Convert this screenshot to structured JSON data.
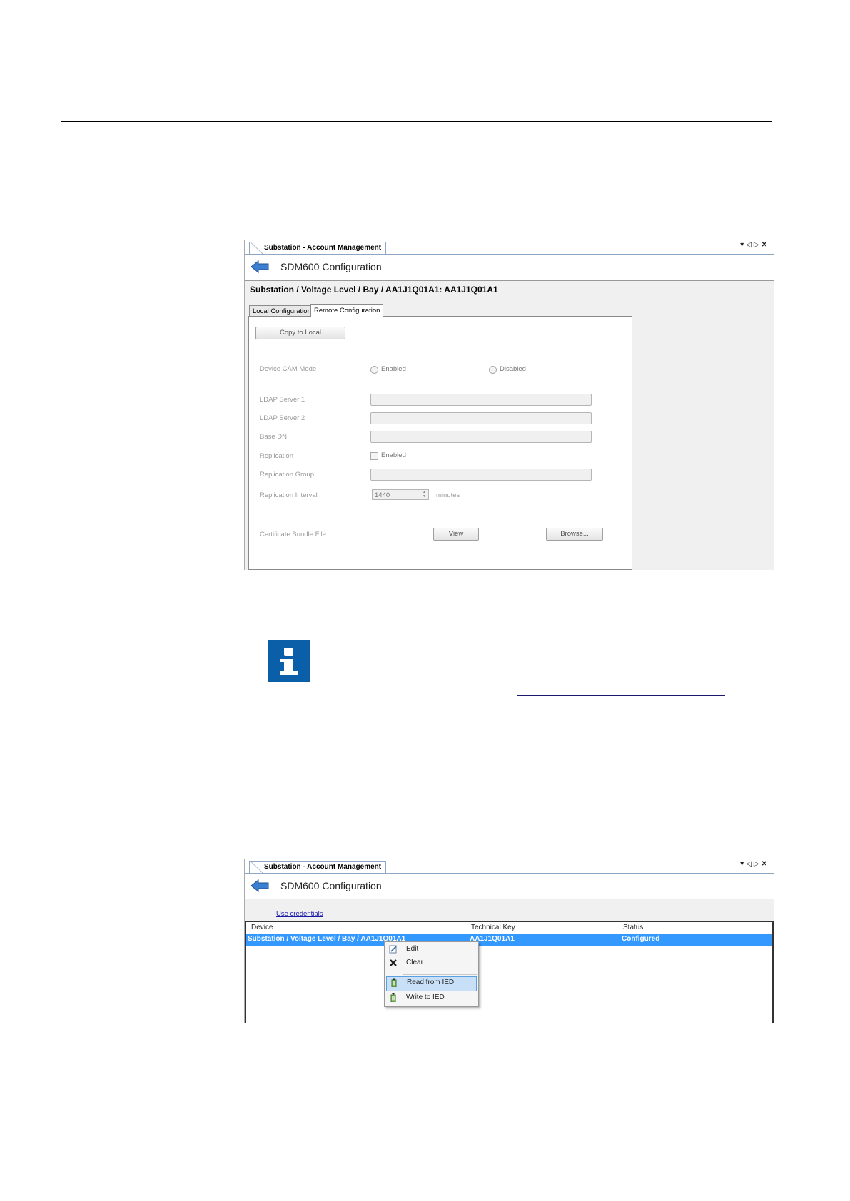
{
  "screenshot1": {
    "doc_tab": "Substation - Account Management",
    "header_title": "SDM600 Configuration",
    "breadcrumb": "Substation / Voltage Level / Bay / AA1J1Q01A1: AA1J1Q01A1",
    "tabs": [
      "Local Configuration",
      "Remote Configuration"
    ],
    "active_tab": "Remote Configuration",
    "copy_button": "Copy to Local",
    "labels": {
      "cam_mode": "Device CAM Mode",
      "ldap1": "LDAP Server 1",
      "ldap2": "LDAP Server 2",
      "base_dn": "Base DN",
      "replication": "Replication",
      "replication_group": "Replication Group",
      "replication_interval": "Replication Interval",
      "cert_bundle": "Certificate Bundle File"
    },
    "options": {
      "enabled": "Enabled",
      "disabled": "Disabled",
      "replication_enabled": "Enabled"
    },
    "interval_value": "1440",
    "interval_unit": "minutes",
    "view_button": "View",
    "browse_button": "Browse..."
  },
  "screenshot2": {
    "doc_tab": "Substation - Account Management",
    "header_title": "SDM600 Configuration",
    "use_credentials": "Use credentials",
    "columns": [
      "Device",
      "Technical Key",
      "Status"
    ],
    "row": {
      "device": "Substation / Voltage Level / Bay / AA1J1Q01A1",
      "technical_key": "AA1J1Q01A1",
      "status": "Configured"
    },
    "context_menu": [
      "Edit",
      "Clear",
      "Read from IED",
      "Write to IED"
    ],
    "highlighted_item": "Read from IED"
  }
}
